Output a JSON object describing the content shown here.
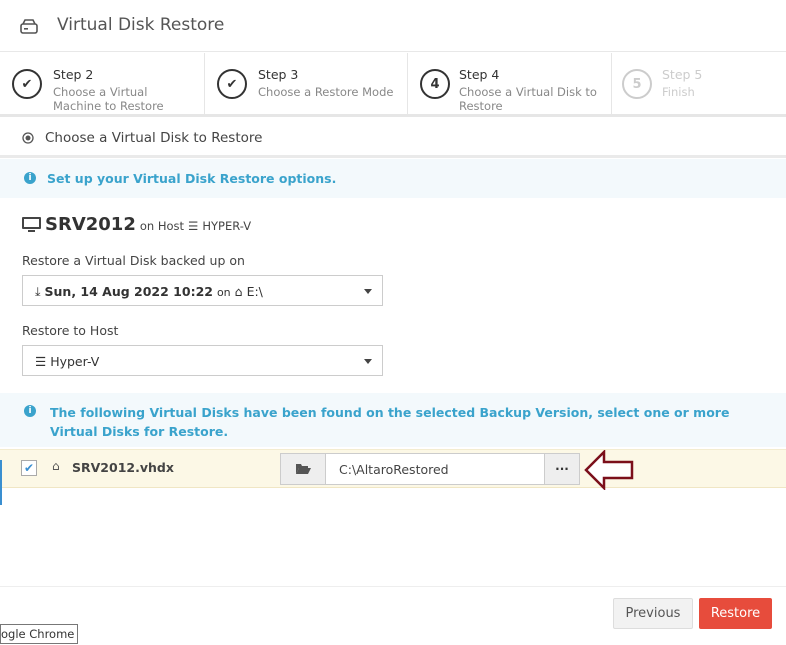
{
  "title": "Virtual Disk Restore",
  "steps": [
    {
      "number": "Step 2",
      "desc": "Choose a Virtual Machine to Restore",
      "state": "done"
    },
    {
      "number": "Step 3",
      "desc": "Choose a Restore Mode",
      "state": "done"
    },
    {
      "number": "Step 4",
      "desc": "Choose a Virtual Disk to Restore",
      "state": "current",
      "badge": "4"
    },
    {
      "number": "Step 5",
      "desc": "Finish",
      "state": "disabled",
      "badge": "5"
    }
  ],
  "section_title": "Choose a Virtual Disk to Restore",
  "info_setup": "Set up your Virtual Disk Restore options.",
  "vm": {
    "name": "SRV2012",
    "on_host": "on Host",
    "host": "HYPER-V"
  },
  "backup": {
    "label": "Restore a Virtual Disk backed up on",
    "date": "Sun, 14 Aug 2022 10:22",
    "on": "on",
    "drive": "E:\\"
  },
  "host_select": {
    "label": "Restore to Host",
    "value": "Hyper-V"
  },
  "info_found": "The following Virtual Disks have been found on the selected Backup Version, select one or more Virtual Disks for Restore.",
  "disk": {
    "name": "SRV2012.vhdx",
    "checked": true,
    "path": "C:\\AltaroRestored",
    "browse": "···"
  },
  "buttons": {
    "previous": "Previous",
    "restore": "Restore"
  },
  "tooltip": "ogle Chrome",
  "colors": {
    "accent": "#3aa3cc",
    "restore": "#e74c3c",
    "arrow": "#7b0f1a"
  }
}
